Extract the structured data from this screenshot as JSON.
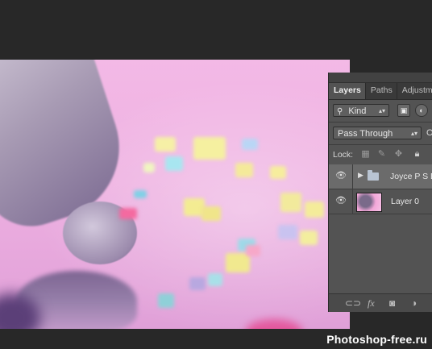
{
  "panel": {
    "tabs": [
      {
        "label": "Layers",
        "active": true
      },
      {
        "label": "Paths",
        "active": false
      },
      {
        "label": "Adjustme",
        "active": false
      }
    ],
    "filter": {
      "label": "Kind",
      "icon": "search-icon"
    },
    "blend_mode": "Pass Through",
    "opacity_label_partial": "O",
    "lock_label": "Lock:",
    "lock_icons": [
      "lock-transparent-pixels-icon",
      "lock-image-pixels-icon",
      "lock-position-icon",
      "lock-all-icon"
    ],
    "layers": [
      {
        "name": "Joyce P S D",
        "type": "group",
        "visible": true,
        "selected": true
      },
      {
        "name": "Layer 0",
        "type": "image",
        "visible": true,
        "selected": false
      }
    ],
    "bottom_icons": [
      "link-layers-icon",
      "fx-icon",
      "add-mask-icon",
      "adjustment-layer-icon"
    ],
    "fx_label": "fx"
  },
  "watermark": "Photoshop-free.ru",
  "colors": {
    "panel_bg": "#535353",
    "tab_bar_bg": "#3a3a3a",
    "workspace_bg": "#282828",
    "selected_layer_bg": "#6b6b6b",
    "canvas_pink": "#eeb0e1"
  }
}
